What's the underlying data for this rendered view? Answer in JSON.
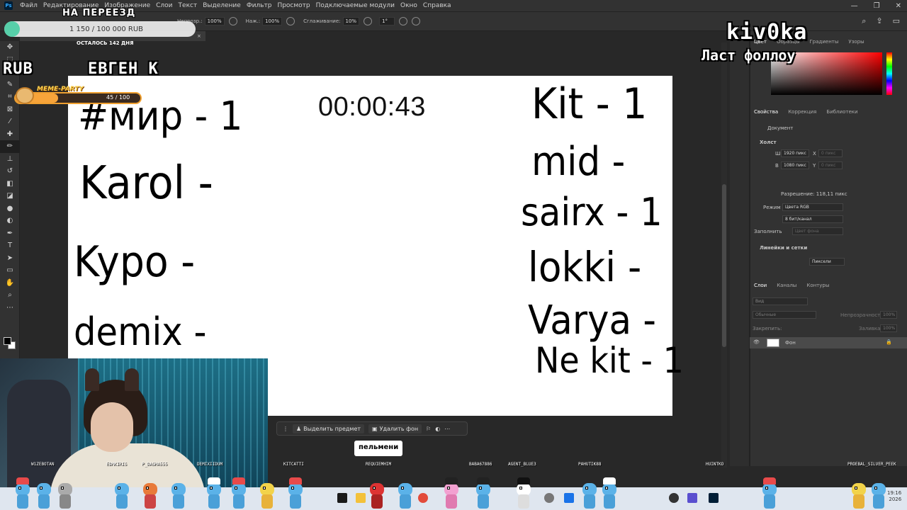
{
  "menubar": {
    "items": [
      "Файл",
      "Редактирование",
      "Изображение",
      "Слои",
      "Текст",
      "Выделение",
      "Фильтр",
      "Просмотр",
      "Подключаемые модули",
      "Окно",
      "Справка"
    ]
  },
  "options": {
    "opacity_label": "Непрозр.:",
    "opacity_value": "100%",
    "pressure_label": "Наж.:",
    "pressure_value": "100%",
    "smoothing_label": "Сглаживание:",
    "smoothing_value": "10%",
    "angle_value": "1°"
  },
  "canvas": {
    "timer": "00:00:43",
    "left_entries": [
      "#мир - 1",
      "Karol -",
      "Kypo -",
      "demix -"
    ],
    "right_entries": [
      "Kit - 1",
      "mid -",
      "sairx - 1",
      "lokki -",
      "Varya -",
      "Ne kit - 1"
    ]
  },
  "panels": {
    "top_tabs": [
      "Цвет",
      "Образцы",
      "Градиенты",
      "Узоры"
    ],
    "properties_tabs": [
      "Свойства",
      "Коррекция",
      "Библиотеки"
    ],
    "document_label": "Документ",
    "canvas_section": "Холст",
    "width_label": "Ш",
    "width_value": "1920 пикс",
    "height_label": "В",
    "height_value": "1080 пикс",
    "x_label": "X",
    "x_value": "0 пикс",
    "y_label": "Y",
    "y_value": "0 пикс",
    "resolution": "Разрешение: 118,11 пикс",
    "mode_label": "Режим",
    "mode_value": "Цвета RGB",
    "depth_value": "8 бит/канал",
    "fill_label": "Заполнить",
    "fill_value": "Цвет фона",
    "rulers_section": "Линейки и сетки",
    "units_value": "Пиксели",
    "layers_tabs": [
      "Слои",
      "Каналы",
      "Контуры"
    ],
    "layer_search": "Вид",
    "blend_mode": "Обычные",
    "opacity_label": "Непрозрачность:",
    "opacity_value": "100%",
    "lock_label": "Закрепить:",
    "fill2_label": "Заливка:",
    "fill2_value": "100%",
    "layer_name": "Фон"
  },
  "context_bar": {
    "select_subject": "Выделить предмет",
    "remove_bg": "Удалить фон"
  },
  "overlay": {
    "goal_title": "НА ПЕРЕЕЗД",
    "goal_amount": "1 150 / 100 000 RUB",
    "goal_progress": 0.0115,
    "goal_days": "ОСТАЛОСЬ 142 ДНЯ",
    "rub_label": "RUB",
    "donor_label": "ЕВГЕН К",
    "meme_label": "MEME-PARTY",
    "meme_count": "45 / 100",
    "streamer": "kiv0ka",
    "last_follow": "Ласт фоллоу",
    "chat_message": "пельмени"
  },
  "pet_names": [
    "W1ZEBOTAN",
    "EDMKIRIS",
    "P_DASHA555",
    "DEMIXIIDUM",
    "KITCATTI",
    "REQUIEMHIM",
    "BABA67886",
    "AGENT_BLUE3",
    "PAHUTIK88",
    "HUINTKO",
    "PROEBAL_SILVER_PEEK"
  ],
  "taskbar": {
    "time": "19:16",
    "year": "2026"
  },
  "colors": {
    "accent_teal": "#5ad8b0",
    "meme_orange": "#f7a43a",
    "ps_dark": "#323232"
  }
}
